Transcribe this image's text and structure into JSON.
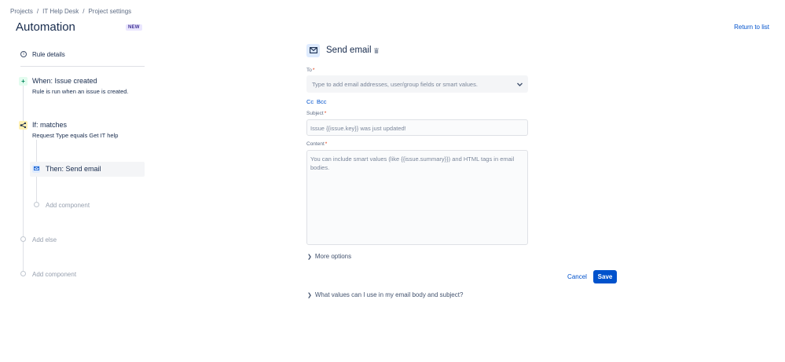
{
  "breadcrumb": [
    "Projects",
    "IT Help Desk",
    "Project settings"
  ],
  "breadcrumb_separator": "/",
  "page_title": "Automation",
  "badge": "NEW",
  "return_link": "Return to list",
  "sidebar": {
    "rule_details": "Rule details",
    "trigger": {
      "title": "When: Issue created",
      "desc": "Rule is run when an issue is created.",
      "icon": "+"
    },
    "condition": {
      "title": "If: matches",
      "desc": "Request Type equals Get IT help"
    },
    "action": {
      "title": "Then: Send email"
    },
    "add_component_inner": "Add component",
    "add_else": "Add else",
    "add_component_outer": "Add component"
  },
  "editor": {
    "title": "Send email",
    "to_label": "To",
    "to_placeholder": "Type to add email addresses, user/group fields or smart values.",
    "cc": "Cc",
    "bcc": "Bcc",
    "subject_label": "Subject",
    "subject_placeholder": "Issue {{issue.key}} was just updated!",
    "content_label": "Content",
    "content_placeholder": "You can include smart values (like {{issue.summary}}) and HTML tags in email bodies.",
    "required_mark": "*",
    "more_options": "More options",
    "cancel": "Cancel",
    "save": "Save",
    "help": "What values can I use in my email body and subject?"
  },
  "colors": {
    "primary": "#0052cc",
    "text": "#172b4d",
    "muted": "#5e6c84",
    "trigger_bg": "#e3fcef",
    "condition_bg": "#fff0b3",
    "action_bg": "#deebff"
  }
}
